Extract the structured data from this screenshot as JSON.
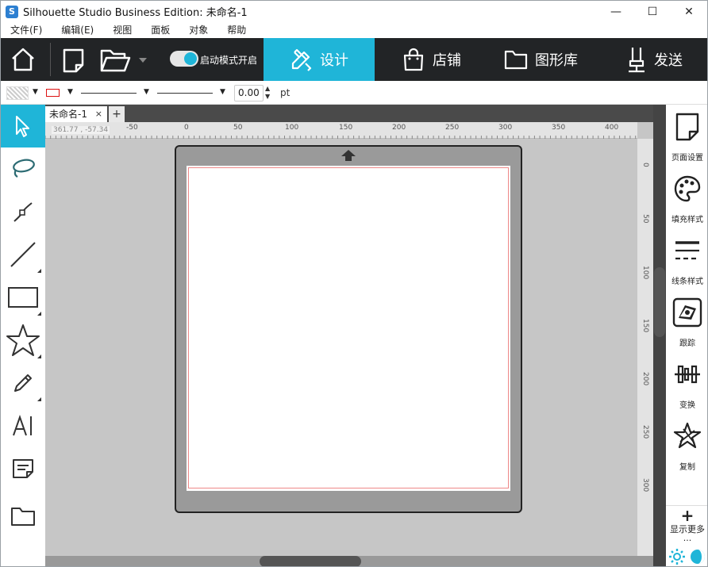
{
  "window": {
    "title": "Silhouette Studio Business Edition: 未命名-1",
    "controls": {
      "minimize": "—",
      "maximize": "☐",
      "close": "✕"
    }
  },
  "menu": [
    "文件(F)",
    "编辑(E)",
    "视图",
    "面板",
    "对象",
    "帮助"
  ],
  "topnav": {
    "autostart_label": "启动模式开启",
    "autostart_on": true,
    "tabs": [
      {
        "label": "设计",
        "active": true
      },
      {
        "label": "店铺",
        "active": false
      },
      {
        "label": "图形库",
        "active": false
      },
      {
        "label": "发送",
        "active": false
      }
    ]
  },
  "toolbar": {
    "line_width_value": "0.00",
    "line_width_unit": "pt",
    "stroke_color": "#dd1111"
  },
  "document": {
    "tab_label": "未命名-1",
    "tab_close": "×",
    "add_tab": "+",
    "coord_readout": "361.77 , -57.34"
  },
  "rulers": {
    "horizontal": [
      "-50",
      "0",
      "50",
      "100",
      "150",
      "200",
      "250",
      "300",
      "350",
      "400"
    ],
    "vertical": [
      "0",
      "50",
      "100",
      "150",
      "200",
      "250",
      "300"
    ]
  },
  "right_panel": {
    "items": [
      {
        "label": "页面设置",
        "icon": "page-setup-icon"
      },
      {
        "label": "填充样式",
        "icon": "palette-icon"
      },
      {
        "label": "线条样式",
        "icon": "line-style-icon"
      },
      {
        "label": "跟踪",
        "icon": "trace-icon"
      },
      {
        "label": "变换",
        "icon": "transform-icon"
      },
      {
        "label": "复制",
        "icon": "replicate-icon"
      }
    ],
    "show_more": "显示更多",
    "show_more_ellipsis": "..."
  },
  "colors": {
    "accent": "#1fb5d8",
    "nav_bg": "#222426",
    "canvas_bg": "#c6c6c6",
    "mat": "#9a9a9a",
    "cut_border": "#e88888"
  }
}
